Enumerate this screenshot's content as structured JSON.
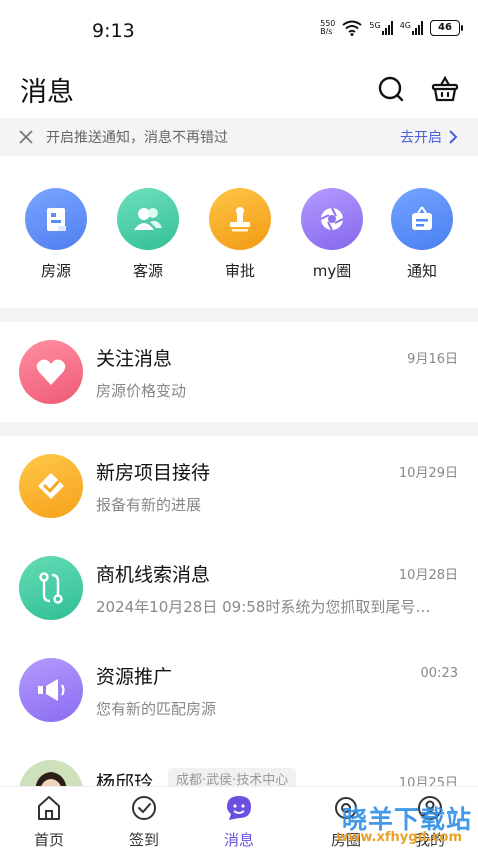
{
  "status_bar": {
    "time": "9:13",
    "net_speed_value": "550",
    "net_speed_unit": "B/s",
    "sig1_label": "5G",
    "sig2_label": "4G",
    "battery": "46"
  },
  "header": {
    "title": "消息",
    "search_icon": "search-icon",
    "basket_icon": "basket-icon"
  },
  "push_banner": {
    "text": "开启推送通知，消息不再错过",
    "action": "去开启"
  },
  "quick_entries": [
    {
      "label": "房源",
      "icon": "building-icon",
      "color": "#5b8ef5"
    },
    {
      "label": "客源",
      "icon": "people-icon",
      "color": "#3fcfa6"
    },
    {
      "label": "审批",
      "icon": "stamp-icon",
      "color": "#f6a821"
    },
    {
      "label": "my圈",
      "icon": "aperture-icon",
      "color": "#9a7cf2"
    },
    {
      "label": "通知",
      "icon": "notice-icon",
      "color": "#4f8df5"
    }
  ],
  "messages": [
    {
      "title": "关注消息",
      "subtitle": "房源价格变动",
      "time": "9月16日",
      "icon": "heart-icon"
    },
    {
      "title": "新房项目接待",
      "subtitle": "报备有新的进展",
      "time": "10月29日",
      "icon": "handshake-icon"
    },
    {
      "title": "商机线索消息",
      "subtitle": "2024年10月28日 09:58时系统为您抓取到尾号…",
      "time": "10月28日",
      "icon": "route-icon"
    },
    {
      "title": "资源推广",
      "subtitle": "您有新的匹配房源",
      "time": "00:23",
      "icon": "megaphone-icon"
    },
    {
      "title": "杨邱玲",
      "tag": "成都·武侯·技术中心",
      "time": "10月25日",
      "icon": "user-avatar"
    }
  ],
  "tabbar": [
    {
      "label": "首页",
      "icon": "home-icon"
    },
    {
      "label": "签到",
      "icon": "checkin-icon"
    },
    {
      "label": "消息",
      "icon": "chat-icon",
      "active": true
    },
    {
      "label": "房圈",
      "icon": "circle-icon"
    },
    {
      "label": "我的",
      "icon": "profile-icon"
    }
  ],
  "watermark": {
    "text": "晓羊下载站",
    "url": "www.xfhygd.com"
  },
  "colors": {
    "accent": "#6b4fe0",
    "link": "#4a5fd8"
  }
}
